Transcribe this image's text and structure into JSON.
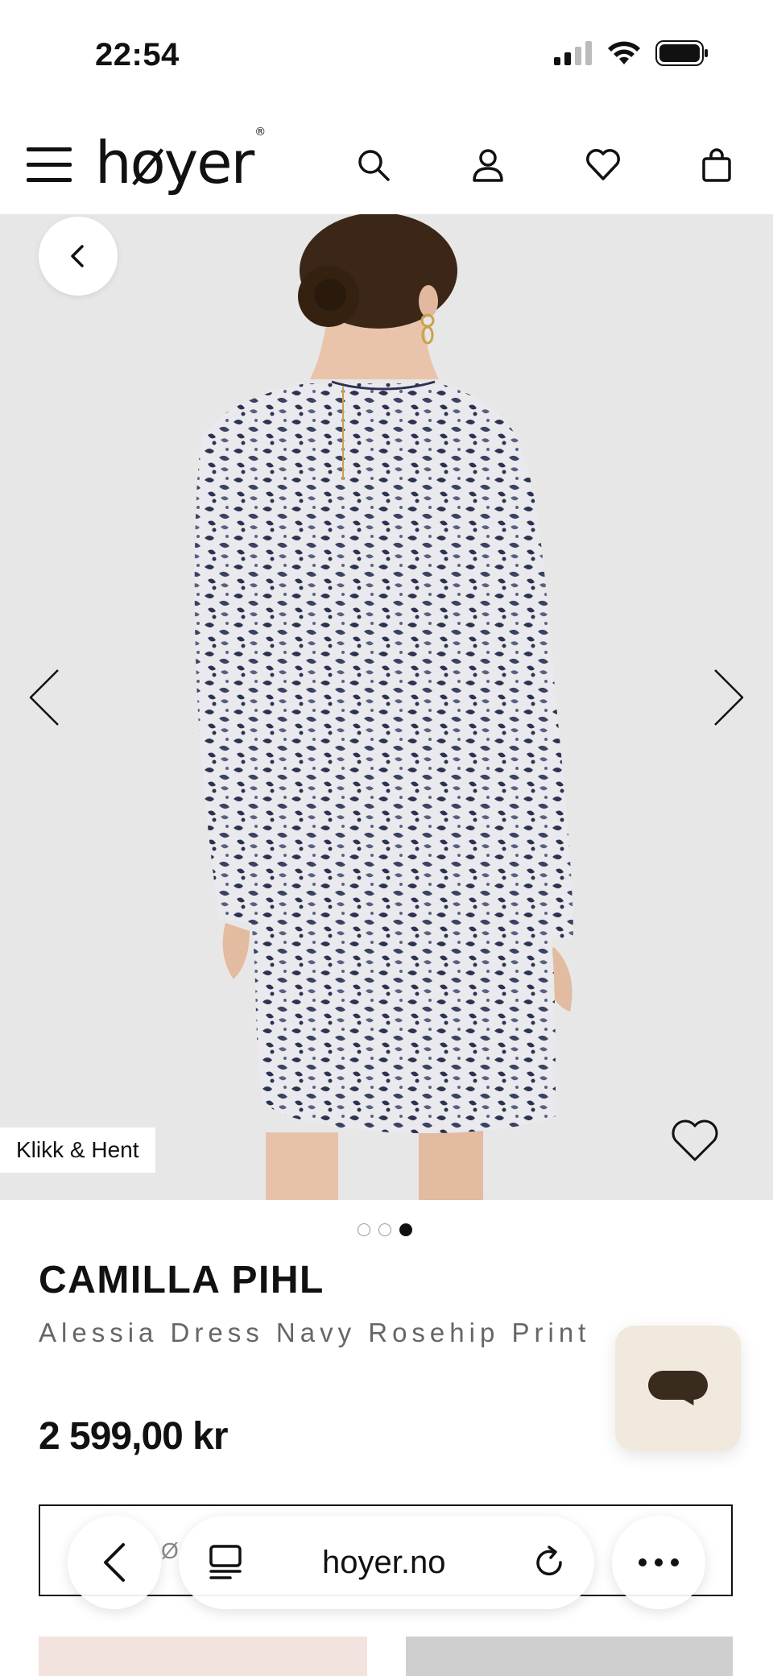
{
  "status_bar": {
    "time": "22:54"
  },
  "header": {
    "logo_text": "høyer",
    "logo_mark": "®"
  },
  "hero": {
    "pickup_badge": "Klikk & Hent",
    "current_slide": 3,
    "slide_count": 3
  },
  "product": {
    "brand": "CAMILLA PIHL",
    "name": "Alessia Dress Navy Rosehip Print",
    "price": "2 599,00 kr",
    "size_placeholder": "Ø"
  },
  "browser": {
    "url": "hoyer.no"
  },
  "colors": {
    "chat_bg": "#f1e9de",
    "chat_bubble": "#3a2b1f",
    "hero_bg": "#e7e7e7"
  },
  "icons": [
    "menu-icon",
    "search-icon",
    "user-icon",
    "heart-icon",
    "bag-icon",
    "chevron-left-icon",
    "chevron-right-icon",
    "chat-icon",
    "tabs-icon",
    "reload-icon",
    "more-icon"
  ]
}
